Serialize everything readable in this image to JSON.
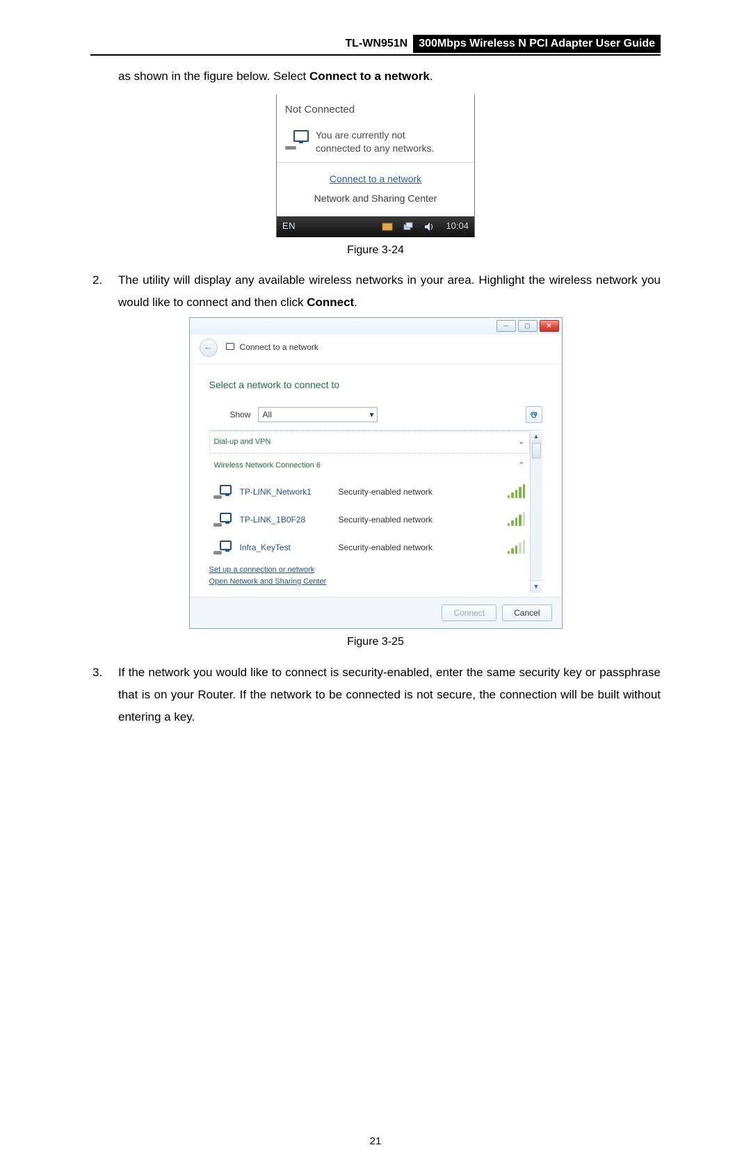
{
  "header": {
    "model": "TL-WN951N",
    "guide_title": "300Mbps Wireless N PCI Adapter User Guide"
  },
  "intro": {
    "lead": "as shown in the figure below. Select ",
    "bold": "Connect to a network",
    "tail": "."
  },
  "popup": {
    "title": "Not Connected",
    "line1": "You are currently not",
    "line2": "connected to any networks.",
    "link": "Connect to a network",
    "sublink": "Network and Sharing Center",
    "lang": "EN",
    "time": "10:04"
  },
  "fig24": "Figure 3-24",
  "step2": {
    "num": "2.",
    "a": "The utility will display any available wireless networks in your area. Highlight the wireless network you would like to connect and then click ",
    "b": "Connect",
    "c": "."
  },
  "dialog": {
    "breadcrumb": "Connect to a network",
    "heading": "Select a network to connect to",
    "show_label": "Show",
    "show_value": "All",
    "group1": "Dial-up and VPN",
    "group2": "Wireless Network Connection 6",
    "networks": [
      {
        "name": "TP-LINK_Network1",
        "desc": "Security-enabled network"
      },
      {
        "name": "TP-LINK_1B0F28",
        "desc": "Security-enabled network"
      },
      {
        "name": "Infra_KeyTest",
        "desc": "Security-enabled network"
      }
    ],
    "link1": "Set up a connection or network",
    "link2": "Open Network and Sharing Center",
    "btn_connect": "Connect",
    "btn_cancel": "Cancel"
  },
  "fig25": "Figure 3-25",
  "step3": {
    "num": "3.",
    "text": "If the network you would like to connect is security-enabled, enter the same security key or passphrase that is on your Router. If the network to be connected is not secure, the connection will be built without entering a key."
  },
  "page_number": "21"
}
